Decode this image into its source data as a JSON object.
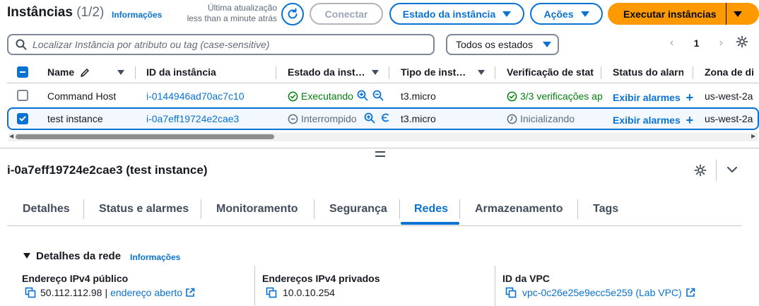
{
  "header": {
    "title": "Instâncias",
    "count": "(1/2)",
    "info_link": "Informações",
    "last_update_line1": "Última atualização",
    "last_update_line2": "less than a minute atrás",
    "connect_label": "Conectar",
    "state_menu_label": "Estado da instância",
    "actions_label": "Ações",
    "launch_label": "Executar instâncias"
  },
  "filter": {
    "search_placeholder": "Localizar Instância por atributo ou tag (case-sensitive)",
    "state_filter": "Todos os estados",
    "page": "1"
  },
  "table": {
    "headers": {
      "name": "Name",
      "id": "ID da instância",
      "state": "Estado da inst…",
      "type": "Tipo de inst…",
      "check": "Verificação de stat",
      "alarm": "Status do alarn",
      "zone": "Zona de di"
    },
    "rows": [
      {
        "name": "Command Host",
        "id": "i-0144946ad70ac7c10",
        "state": "Executando",
        "type": "t3.micro",
        "check": "3/3 verificações ap",
        "alarm": "Exibir alarmes",
        "zone": "us-west-2a",
        "selected": false
      },
      {
        "name": "test instance",
        "id": "i-0a7eff19724e2cae3",
        "state": "Interrompido",
        "type": "t3.micro",
        "check": "Inicializando",
        "alarm": "Exibir alarmes",
        "zone": "us-west-2a",
        "selected": true
      }
    ]
  },
  "details": {
    "title": "i-0a7eff19724e2cae3 (test instance)",
    "tabs": [
      "Detalhes",
      "Status e alarmes",
      "Monitoramento",
      "Segurança",
      "Redes",
      "Armazenamento",
      "Tags"
    ],
    "active_tab": "Redes",
    "section_title": "Detalhes da rede",
    "section_info": "Informações",
    "public_ipv4_label": "Endereço IPv4 público",
    "public_ipv4_value": "50.112.112.98",
    "public_ipv4_sep": "|",
    "public_ipv4_link": "endereço aberto",
    "private_ipv4_label": "Endereços IPv4 privados",
    "private_ipv4_value": "10.0.10.254",
    "vpc_label": "ID da VPC",
    "vpc_value": "vpc-0c26e25e9ecc5e259 (Lab VPC)"
  },
  "colors": {
    "link": "#0972d3",
    "primary": "#ff9900",
    "success": "#037f0c",
    "muted": "#5f6b7a"
  }
}
